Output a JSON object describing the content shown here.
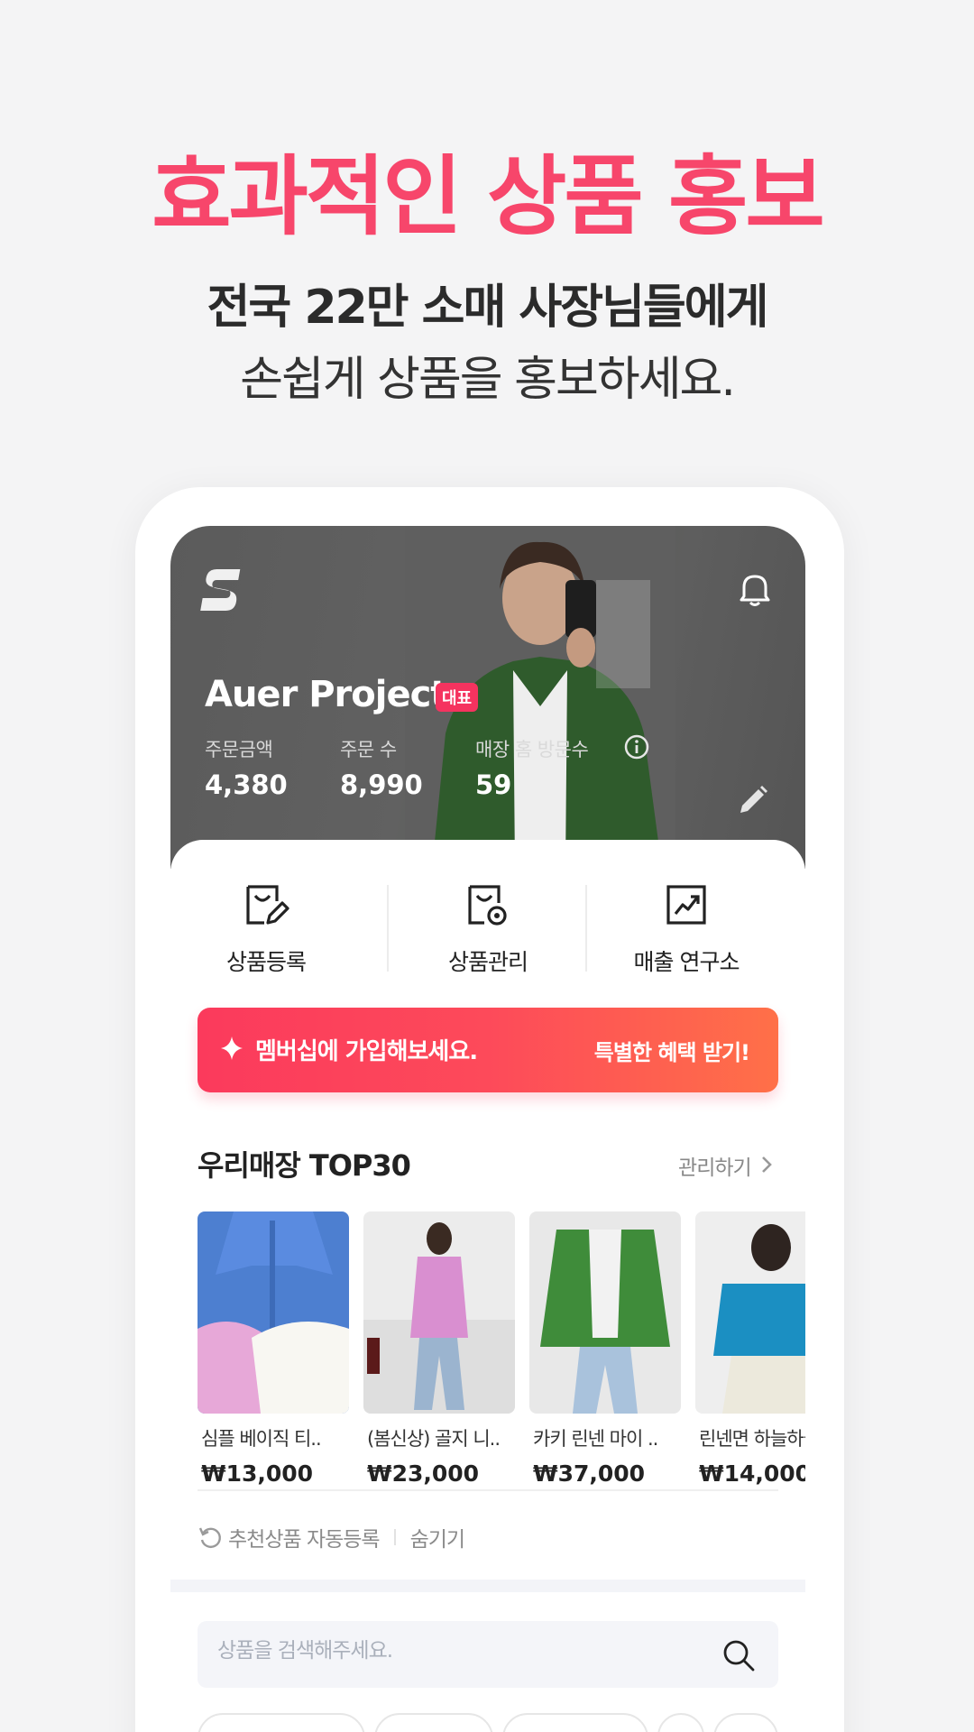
{
  "promo": {
    "title": "효과적인 상품 홍보",
    "line1": "전국 22만 소매 사장님들에게",
    "line2": "손쉽게 상품을 홍보하세요."
  },
  "store": {
    "name": "Auer Project",
    "badge": "대표",
    "stats": [
      {
        "label": "주문금액",
        "value": "4,380"
      },
      {
        "label": "주문 수",
        "value": "8,990"
      },
      {
        "label": "매장 홈 방문수",
        "value": "59"
      }
    ]
  },
  "quick_actions": [
    {
      "label": "상품등록",
      "icon": "product-register-icon"
    },
    {
      "label": "상품관리",
      "icon": "product-manage-icon"
    },
    {
      "label": "매출 연구소",
      "icon": "sales-lab-icon"
    }
  ],
  "membership": {
    "text": "멤버십에 가입해보세요.",
    "cta": "특별한 혜택 받기!"
  },
  "top30": {
    "title": "우리매장 TOP30",
    "manage_label": "관리하기",
    "products": [
      {
        "name": "심플 베이직 티..",
        "price": "₩13,000"
      },
      {
        "name": "(봄신상) 골지 니..",
        "price": "₩23,000"
      },
      {
        "name": "카키 린넨 마이 ..",
        "price": "₩37,000"
      },
      {
        "name": "린넨면 하늘하늘",
        "price": "₩14,000"
      }
    ]
  },
  "auto_register": {
    "label": "추천상품 자동등록",
    "hide_label": "숨기기"
  },
  "search": {
    "placeholder": "상품을 검색해주세요."
  },
  "colors": {
    "accent": "#f7466b",
    "membership_start": "#fb3a5c",
    "membership_end": "#ff7048"
  }
}
